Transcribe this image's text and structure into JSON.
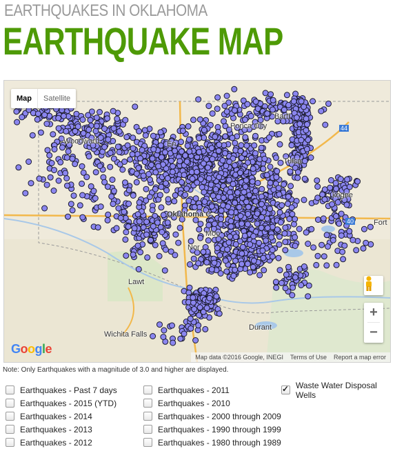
{
  "header": {
    "supertitle": "EARTHQUAKES IN OKLAHOMA",
    "title": "EARTHQUAKE MAP"
  },
  "map": {
    "map_type": {
      "map_label": "Map",
      "satellite_label": "Satellite",
      "selected": "Map"
    },
    "logo_letters": [
      "G",
      "o",
      "o",
      "g",
      "l",
      "e"
    ],
    "attribution": {
      "data": "Map data ©2016 Google, INEGI",
      "terms": "Terms of Use",
      "report": "Report a map error"
    },
    "zoom": {
      "in": "+",
      "out": "−"
    },
    "place_labels": [
      "Woodward",
      "Ponca City",
      "Bartl",
      "Tulsa",
      "Oklahoma C",
      "Nor",
      "Lawt",
      "Wichita Falls",
      "Durant",
      "Moo",
      "kogee",
      "Fort",
      "En",
      "44",
      "40"
    ],
    "colors": {
      "quake_fill": "#8b86f0",
      "quake_stroke": "#1a1a2e",
      "accent": "#4e9a06"
    }
  },
  "note": "Note: Only Earthquakes with a magnitude of 3.0 and higher are displayed.",
  "filters": {
    "col1": [
      {
        "label": "Earthquakes - Past 7 days",
        "checked": false
      },
      {
        "label": "Earthquakes - 2015 (YTD)",
        "checked": false
      },
      {
        "label": "Earthquakes - 2014",
        "checked": false
      },
      {
        "label": "Earthquakes - 2013",
        "checked": false
      },
      {
        "label": "Earthquakes - 2012",
        "checked": false
      }
    ],
    "col2": [
      {
        "label": "Earthquakes - 2011",
        "checked": false
      },
      {
        "label": "Earthquakes - 2010",
        "checked": false
      },
      {
        "label": "Earthquakes - 2000 through 2009",
        "checked": false
      },
      {
        "label": "Earthquakes - 1990 through 1999",
        "checked": false
      },
      {
        "label": "Earthquakes - 1980 through 1989",
        "checked": false
      }
    ],
    "col3": [
      {
        "label": "Waste Water Disposal Wells",
        "checked": true
      }
    ]
  }
}
